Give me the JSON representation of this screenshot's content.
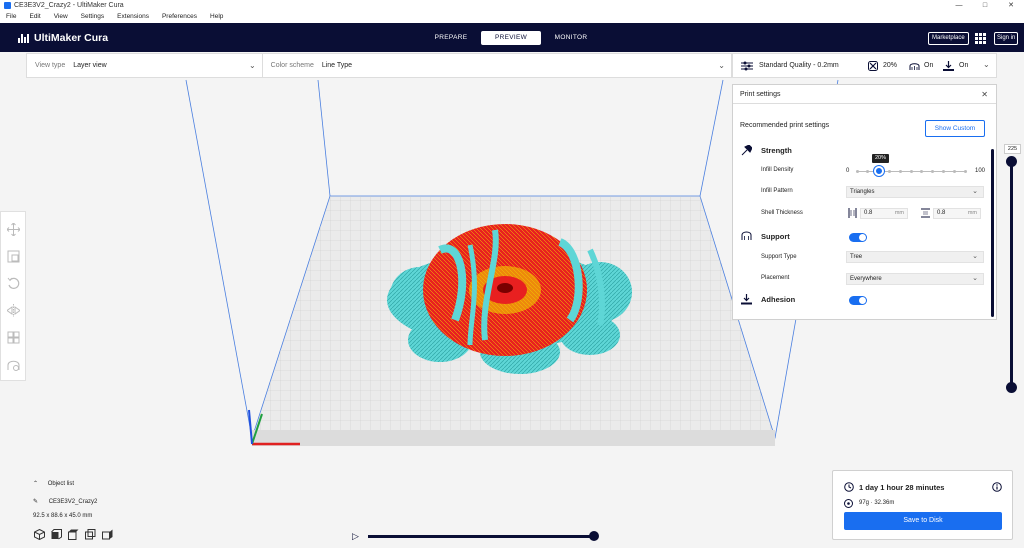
{
  "window": {
    "title": "CE3E3V2_Crazy2 - UltiMaker Cura",
    "controls": [
      "—",
      "□",
      "✕"
    ]
  },
  "menu": [
    "File",
    "Edit",
    "View",
    "Settings",
    "Extensions",
    "Preferences",
    "Help"
  ],
  "header": {
    "logo": "UltiMaker Cura",
    "stages": [
      "PREPARE",
      "PREVIEW",
      "MONITOR"
    ],
    "active_stage": "PREVIEW",
    "marketplace": "Marketplace",
    "sign_in": "Sign in"
  },
  "view_type": {
    "label": "View type",
    "value": "Layer view"
  },
  "color_scheme": {
    "label": "Color scheme",
    "value": "Line Type"
  },
  "quality": {
    "profile": "Standard Quality - 0.2mm",
    "infill": "20%",
    "support": "On",
    "adhesion": "On"
  },
  "print_settings": {
    "title": "Print settings",
    "recommended": "Recommended print settings",
    "show_custom": "Show Custom",
    "strength": {
      "title": "Strength",
      "infill_density_label": "Infill Density",
      "infill_min": "0",
      "infill_max": "100",
      "infill_value": "20%",
      "infill_fraction": 0.2,
      "infill_pattern_label": "Infill Pattern",
      "infill_pattern": "Triangles",
      "shell_thickness_label": "Shell Thickness",
      "wall_thickness": "0.8",
      "top_bottom_thickness": "0.8",
      "unit": "mm"
    },
    "support": {
      "title": "Support",
      "support_type_label": "Support Type",
      "support_type": "Tree",
      "placement_label": "Placement",
      "placement": "Everywhere",
      "enabled": true
    },
    "adhesion": {
      "title": "Adhesion",
      "enabled": true
    }
  },
  "layer_slider": {
    "value": "225"
  },
  "object_list": {
    "toggle_label": "Object list",
    "object_name": "CE3E3V2_Crazy2",
    "dimensions": "92.5 x 88.6 x 45.0 mm"
  },
  "output": {
    "print_time": "1 day 1 hour 28 minutes",
    "material": "97g · 32.36m",
    "save": "Save to Disk"
  },
  "colors": {
    "accent": "#196ef0",
    "header": "#0a0e35",
    "support": "#5ed6d6",
    "wall": "#e82020"
  }
}
